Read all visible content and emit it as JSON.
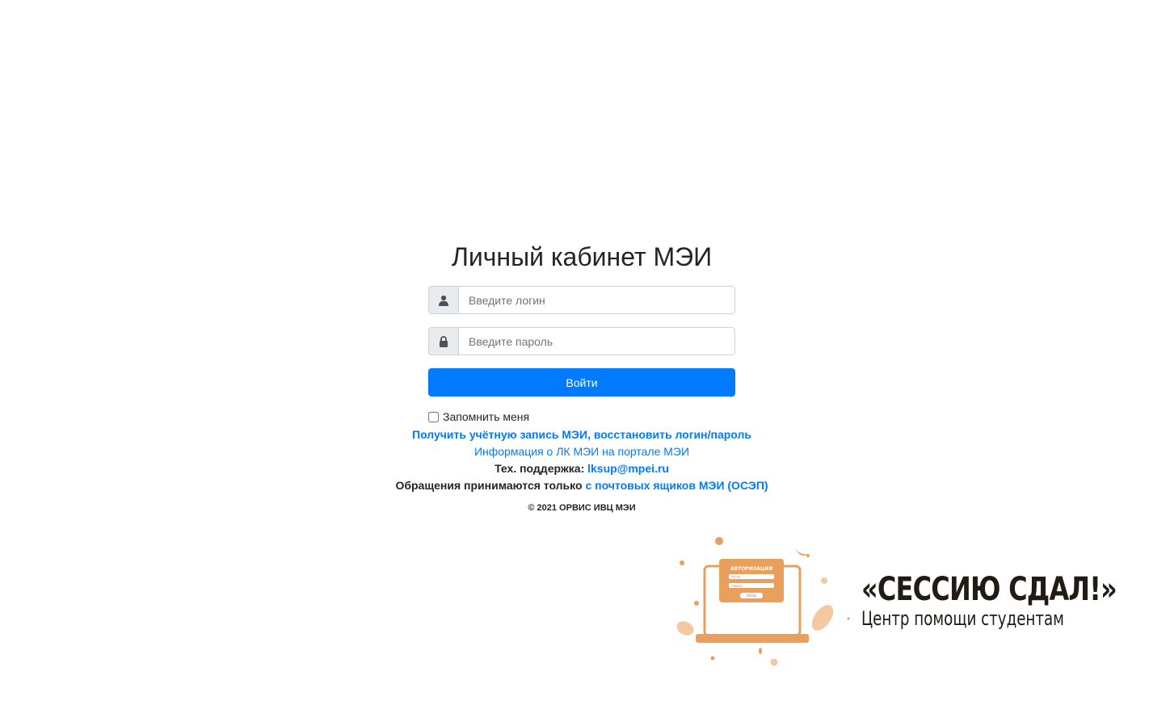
{
  "page": {
    "title": "Личный кабинет МЭИ"
  },
  "login_form": {
    "login_placeholder": "Введите логин",
    "password_placeholder": "Введите пароль",
    "submit_label": "Войти",
    "remember_label": "Запомнить меня",
    "login_icon": "user-icon",
    "password_icon": "lock-icon"
  },
  "links": {
    "get_account": "Получить учётную запись МЭИ, восстановить логин/пароль",
    "info": "Информация о ЛК МЭИ на портале МЭИ",
    "support_label": "Тех. поддержка:",
    "support_email": "lksup@mpei.ru",
    "requests_label": "Обращения принимаются только",
    "requests_link": "с почтовых ящиков МЭИ (ОСЭП)"
  },
  "footer": {
    "copyright": "© 2021 ОРВИС ИВЦ МЭИ"
  },
  "promo": {
    "title": "«СЕССИЮ СДАЛ!»",
    "subtitle": "Центр помощи студентам",
    "screen_heading": "АВТОРИЗАЦИЯ",
    "field_1": "Логин",
    "field_2": "Пароль",
    "button": "ВХОД",
    "accent_color": "#e8a05c",
    "text_color": "#221b13"
  }
}
